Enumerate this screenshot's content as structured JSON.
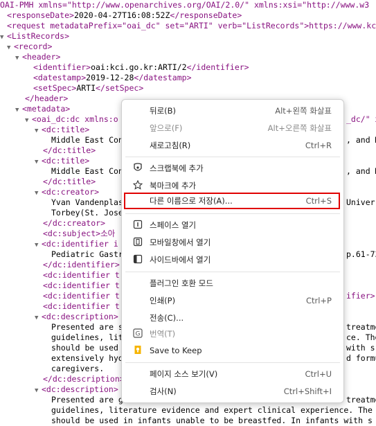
{
  "xml": {
    "l1": "OAI-PMH xmlns=\"http://www.openarchives.org/OAI/2.0/\" xmlns:xsi=\"http://www.w3",
    "l2_date": "2020-04-27T16:08:52Z",
    "l3": "<request metadataPrefix=\"oai_dc\" set=\"ARTI\" verb=\"ListRecords\">https://www.kc",
    "identifier": "oai:kci.go.kr:ARTI/2",
    "datestamp": "2019-12-28",
    "setSpec": "ARTI",
    "dc_ns": "<oai_dc:dc xmlns:o",
    "dc_ns_right": "_dc/\" x",
    "title_text": "Middle East Con",
    "title_right": ", and M",
    "creator1": "Yvan Vandenplas",
    "creator1_right": "Univer",
    "creator2": "Torbey(St. Jose",
    "subject": "<dc:subject>소아",
    "identifier_open": "<dc:identifier i",
    "identifier_text": "Pediatric Gastr",
    "identifier_right": "p.61-73",
    "identifier_t": "<dc:identifier t",
    "identifier_right2": "ifier>",
    "desc_p1": "Presented are s",
    "desc_p1_right": "treatme",
    "desc_p2": "guidelines, lit",
    "desc_p2_right": "ce. The",
    "desc_p3": "should be used",
    "desc_p3_right": "with s",
    "desc_p4": "extensively hyd",
    "desc_p4_right": "d formu",
    "desc_p5": "caregivers.",
    "desc2_p1": "Presented are g",
    "desc2_p1_right": "treatme",
    "desc2_p2": "guidelines, literature evidence and expert clinical experience. The",
    "desc2_p3": "should be used in infants unable to be breastfed. In infants with s"
  },
  "menu": {
    "items": [
      {
        "label": "뒤로(B)",
        "shortcut": "Alt+왼쪽 화살표",
        "disabled": false
      },
      {
        "label": "앞으로(F)",
        "shortcut": "Alt+오른쪽 화살표",
        "disabled": true
      },
      {
        "label": "새로고침(R)",
        "shortcut": "Ctrl+R",
        "disabled": false
      },
      {
        "label": "스크랩북에 추가",
        "shortcut": "",
        "icon": "scrapbook-icon"
      },
      {
        "label": "북마크에 추가",
        "shortcut": "",
        "icon": "star-icon"
      },
      {
        "label": "다른 이름으로 저장(A)...",
        "shortcut": "Ctrl+S"
      },
      {
        "label": "스페이스 열기",
        "shortcut": "",
        "icon": "spaces-icon"
      },
      {
        "label": "모바일창에서 열기",
        "shortcut": "",
        "icon": "mobile-icon"
      },
      {
        "label": "사이드바에서 열기",
        "shortcut": "",
        "icon": "sidebar-icon"
      },
      {
        "label": "플러그인 호환 모드",
        "shortcut": ""
      },
      {
        "label": "인쇄(P)",
        "shortcut": "Ctrl+P"
      },
      {
        "label": "전송(C)...",
        "shortcut": ""
      },
      {
        "label": "번역(T)",
        "shortcut": "",
        "icon": "translate-icon",
        "disabled": true
      },
      {
        "label": "Save to Keep",
        "shortcut": "",
        "icon": "keep-icon"
      },
      {
        "label": "페이지 소스 보기(V)",
        "shortcut": "Ctrl+U"
      },
      {
        "label": "검사(N)",
        "shortcut": "Ctrl+Shift+I"
      }
    ],
    "highlight_color": "#e00000"
  }
}
